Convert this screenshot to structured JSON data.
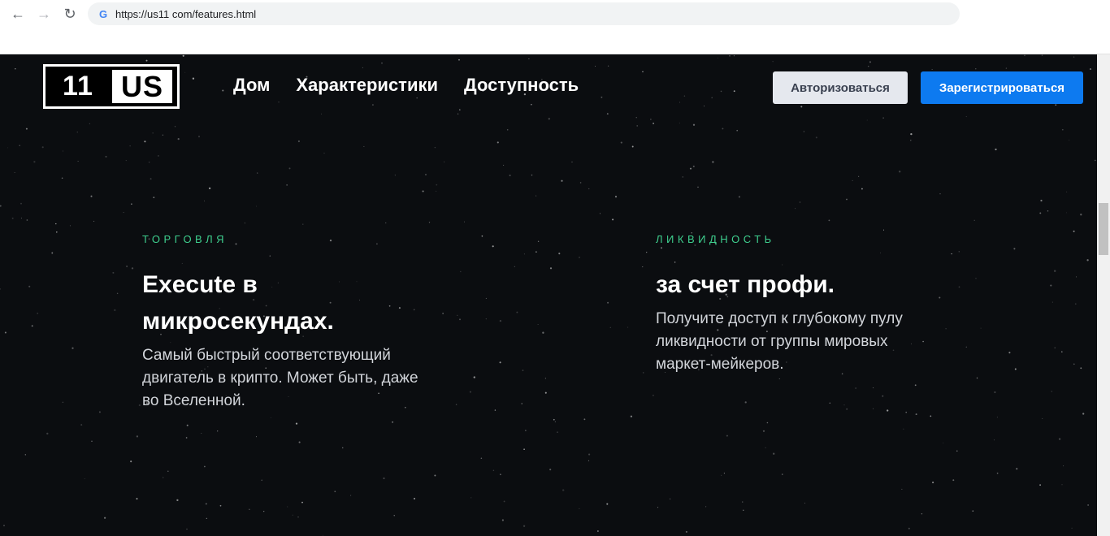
{
  "browser": {
    "url": "https://us11 com/features.html",
    "back_icon": "←",
    "forward_icon": "→",
    "reload_icon": "↻",
    "site_icon": "G"
  },
  "header": {
    "logo_left": "11",
    "logo_right": "US",
    "nav": [
      "Дом",
      "Характеристики",
      "Доступность"
    ],
    "login_label": "Авторизоваться",
    "register_label": "Зарегистрироваться"
  },
  "features": [
    {
      "eyebrow": "ТОРГОВЛЯ",
      "title_line1": "Execute в",
      "title_line2": "микросекундах.",
      "desc_line1": "Самый быстрый соответствующий",
      "desc_line2": "двигатель в крипто. Может быть, даже",
      "desc_line3": "во Вселенной."
    },
    {
      "eyebrow": "ЛИКВИДНОСТЬ",
      "title_line1": "за счет профи.",
      "desc_line1": "Получите доступ к глубокому пулу",
      "desc_line2": "ликвидности от группы мировых",
      "desc_line3": "маркет-мейкеров."
    }
  ],
  "colors": {
    "page_bg": "#0b0d10",
    "accent_green": "#3ecf8e",
    "register_blue": "#0d7af0",
    "login_gray": "#e5e8ee"
  }
}
